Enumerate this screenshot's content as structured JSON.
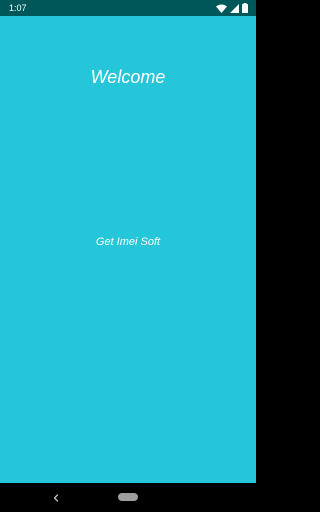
{
  "status_bar": {
    "time": "1:07",
    "icons": [
      "wifi-icon",
      "signal-icon",
      "battery-icon"
    ],
    "background": "#00575a"
  },
  "screen": {
    "background": "#26c6da",
    "title": "Welcome",
    "action_text": "Get Imei Soft"
  },
  "nav_bar": {
    "buttons": [
      "back-icon",
      "home-pill"
    ],
    "background": "#000000"
  }
}
